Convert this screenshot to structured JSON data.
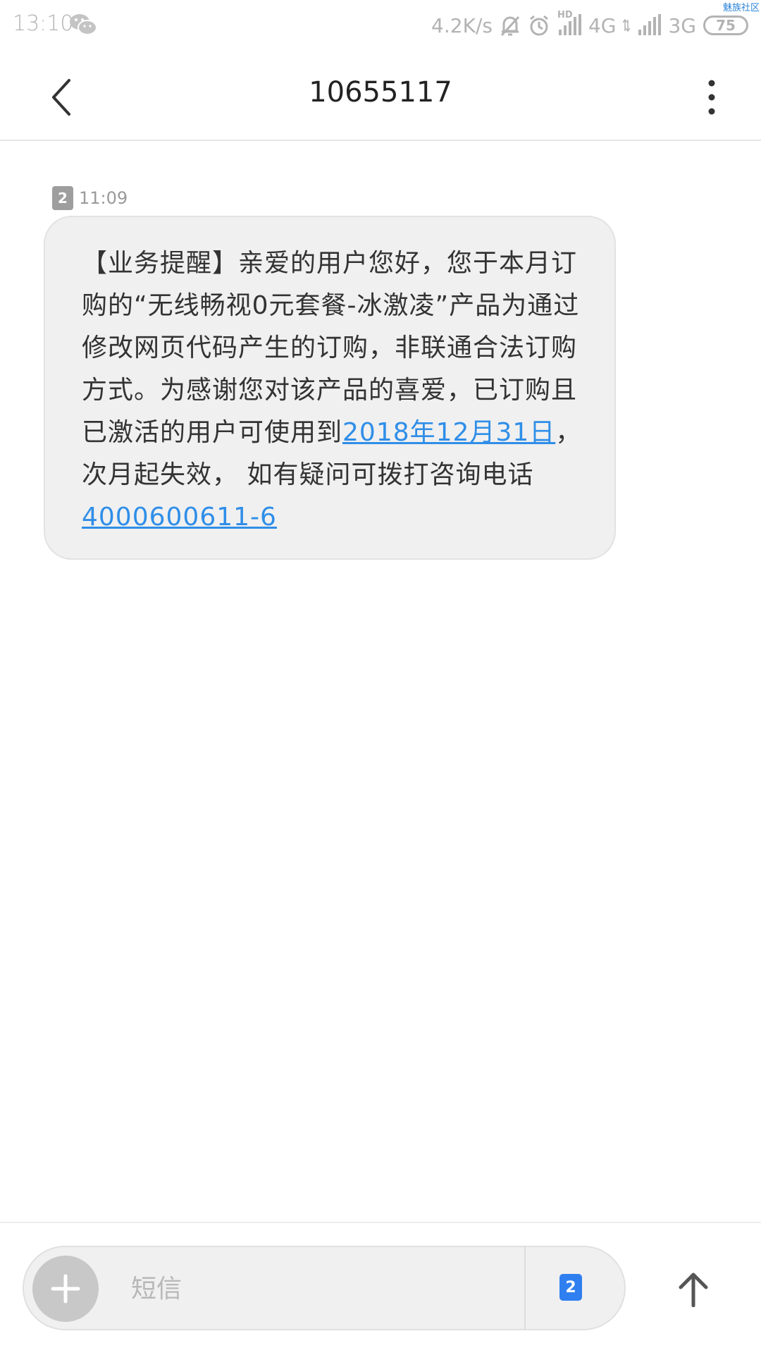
{
  "status_bar": {
    "time": "13:10",
    "network_speed": "4.2K/s",
    "hd_label": "HD",
    "net1": "4G",
    "net2": "3G",
    "battery": "75",
    "watermark": "魅族社区"
  },
  "header": {
    "title": "10655117"
  },
  "message": {
    "sim": "2",
    "time": "11:09",
    "text_part1": "【业务提醒】亲爱的用户您好，您于本月订购的“无线畅视0元套餐-冰激凌”产品为通过修改网页代码产生的订购，非联通合法订购方式。为感谢您对该产品的喜爱，已订购且已激活的用户可使用到",
    "link_date": "2018年12月31日",
    "text_part2": "，次月起失效，  如有疑问可拨打咨询电话",
    "link_phone": "4000600611-6"
  },
  "composer": {
    "placeholder": "短信",
    "sim": "2"
  },
  "colors": {
    "link": "#2f8ee8",
    "sim_send_badge": "#2f7ff0",
    "bubble_bg": "#f0f0f0"
  }
}
